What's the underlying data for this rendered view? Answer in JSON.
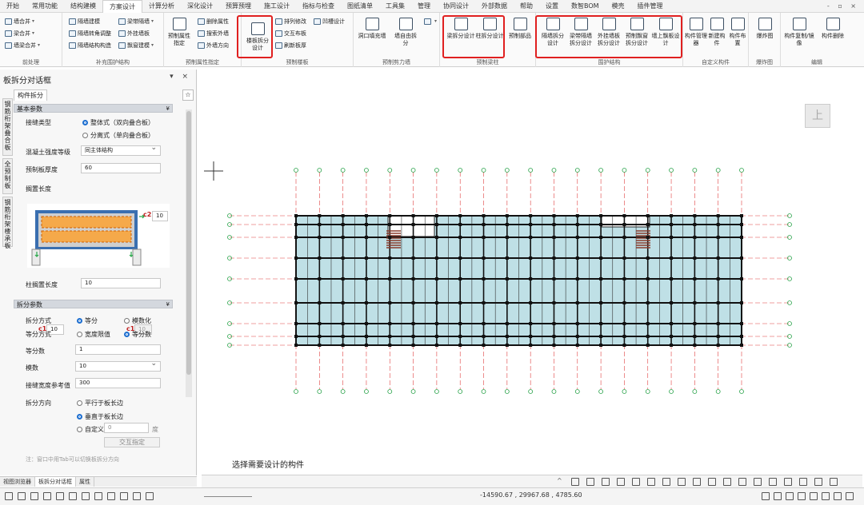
{
  "menu": [
    "开始",
    "常用功能",
    "结构建模",
    "方案设计",
    "计算分析",
    "深化设计",
    "预算预埋",
    "施工设计",
    "指标与检查",
    "图纸清单",
    "工具集",
    "管理",
    "协同设计",
    "外部数据",
    "帮助",
    "设置",
    "数智BOM",
    "模壳",
    "插件管理"
  ],
  "active_menu_index": 3,
  "window_controls": "- ▫ ×",
  "ribbon": {
    "groups": [
      "前处理",
      "补充围护结构",
      "预制属性指定",
      "预制楼板",
      "预制剪力墙",
      "预制梁柱",
      "围护结构",
      "自定义构件",
      "爆炸图",
      "编辑"
    ],
    "preprocess": [
      "墙合并",
      "梁合并",
      "墙梁合并"
    ],
    "supplement": [
      "隔墙建模",
      "隔墙转角调整",
      "隔墙结构构造",
      "梁带隔墙",
      "外挂墙板",
      "飘窗建模"
    ],
    "attr": {
      "big": "预制属性指定",
      "items": [
        "删除属性",
        "搜索外墙",
        "外墙方向"
      ]
    },
    "slab": {
      "big": "楼板拆分设计",
      "items": [
        "排列修改",
        "交互布板",
        "刷新板厚",
        "凹槽设计"
      ]
    },
    "wall": {
      "items": [
        "洞口填充墙",
        "墙自由拆分",
        "预制部品"
      ]
    },
    "beamcol": {
      "items": [
        "梁拆分设计",
        "柱拆分设计"
      ]
    },
    "envelope": {
      "items": [
        "隔墙拆分设计",
        "梁带隔墙拆分设计",
        "外挂墙板拆分设计",
        "预制飘窗拆分设计",
        "墙上飘板设计"
      ]
    },
    "custom": {
      "items": [
        "构件管理器",
        "新建构件",
        "构件布置"
      ]
    },
    "explode": {
      "items": [
        "爆炸图"
      ]
    },
    "edit": {
      "items": [
        "构件复制/镜像",
        "构件删除"
      ]
    }
  },
  "panel": {
    "title": "板拆分对话框",
    "controls": "▾ ×",
    "vtabs": [
      "钢筋桁架叠合板",
      "全预制板",
      "钢筋桁架楼承板"
    ],
    "subtab": "构件拆分",
    "pin": "☆",
    "sec_basic": "基本参数",
    "joint_type_label": "接缝类型",
    "joint_opts": [
      "整体式（双向叠合板）",
      "分离式（单向叠合板）"
    ],
    "concrete_label": "混凝土强度等级",
    "concrete_value": "同主体结构",
    "thickness_label": "预制板厚度",
    "thickness_value": "60",
    "rest_label": "搁置长度",
    "c2_label": "c2",
    "c2_value": "10",
    "c1_label": "c1",
    "c1a_value": "10",
    "c1b_value": "10",
    "col_rest_label": "柱搁置长度",
    "col_rest_value": "10",
    "sec_split": "拆分参数",
    "split_mode_label": "拆分方式",
    "split_mode_opts": [
      "等分",
      "模数化"
    ],
    "equal_mode_label": "等分方式",
    "equal_mode_opts": [
      "宽度限值",
      "等分数"
    ],
    "count_label": "等分数",
    "count_value": "1",
    "modulus_label": "模数",
    "modulus_value": "10",
    "joint_width_label": "接缝宽度参考值",
    "joint_width_value": "300",
    "dir_label": "拆分方向",
    "dir_opts": [
      "平行于板长边",
      "垂直于板长边",
      "自定义"
    ],
    "custom_value": "0",
    "custom_unit": "度",
    "interactive_btn": "交互指定",
    "note": "注：窗口中用Tab可以切换板拆分方向"
  },
  "bottom_tabs": [
    "视图浏览器",
    "板拆分对话框",
    "属性"
  ],
  "canvas": {
    "up_button": "上",
    "prompt": "选择需要设计的构件"
  },
  "status": {
    "coords": "-14590.67 , 29967.68 , 4785.60"
  },
  "colors": {
    "highlight": "#e02020",
    "slab_fill": "#bfe0e6",
    "axis_red": "#e04040",
    "axis_green": "#29a34a"
  }
}
